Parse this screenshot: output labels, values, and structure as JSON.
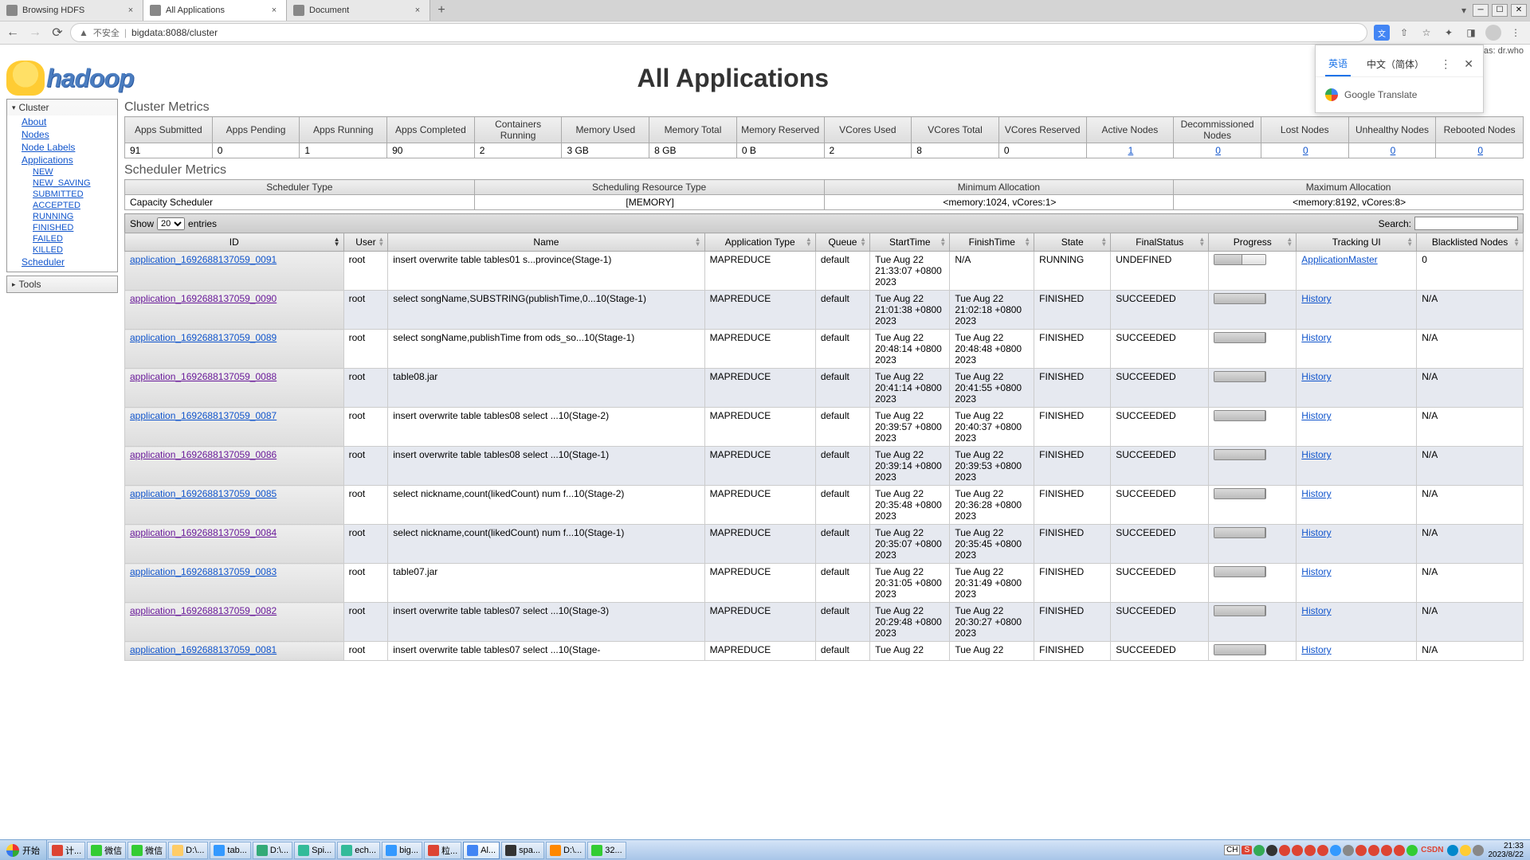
{
  "browser": {
    "tabs": [
      {
        "title": "Browsing HDFS",
        "active": false
      },
      {
        "title": "All Applications",
        "active": true
      },
      {
        "title": "Document",
        "active": false
      }
    ],
    "url_warn": "▲",
    "url_secure": "不安全",
    "url": "bigdata:8088/cluster"
  },
  "translate": {
    "tab1": "英语",
    "tab2": "中文（简体）",
    "label": "Google Translate"
  },
  "login": "gged in as: dr.who",
  "page_title": "All Applications",
  "logo_text": "hadoop",
  "sidebar": {
    "cluster": "Cluster",
    "items": [
      "About",
      "Nodes",
      "Node Labels",
      "Applications"
    ],
    "app_states": [
      "NEW",
      "NEW_SAVING",
      "SUBMITTED",
      "ACCEPTED",
      "RUNNING",
      "FINISHED",
      "FAILED",
      "KILLED"
    ],
    "scheduler": "Scheduler",
    "tools": "Tools"
  },
  "cluster_metrics": {
    "title": "Cluster Metrics",
    "headers": [
      "Apps Submitted",
      "Apps Pending",
      "Apps Running",
      "Apps Completed",
      "Containers Running",
      "Memory Used",
      "Memory Total",
      "Memory Reserved",
      "VCores Used",
      "VCores Total",
      "VCores Reserved",
      "Active Nodes",
      "Decommissioned Nodes",
      "Lost Nodes",
      "Unhealthy Nodes",
      "Rebooted Nodes"
    ],
    "values": [
      "91",
      "0",
      "1",
      "90",
      "2",
      "3 GB",
      "8 GB",
      "0 B",
      "2",
      "8",
      "0",
      "1",
      "0",
      "0",
      "0",
      "0"
    ],
    "links": [
      false,
      false,
      false,
      false,
      false,
      false,
      false,
      false,
      false,
      false,
      false,
      true,
      true,
      true,
      true,
      true
    ]
  },
  "scheduler_metrics": {
    "title": "Scheduler Metrics",
    "headers": [
      "Scheduler Type",
      "Scheduling Resource Type",
      "Minimum Allocation",
      "Maximum Allocation"
    ],
    "values": [
      "Capacity Scheduler",
      "[MEMORY]",
      "<memory:1024, vCores:1>",
      "<memory:8192, vCores:8>"
    ]
  },
  "dt": {
    "show": "Show",
    "entries": "entries",
    "page_size": "20",
    "search": "Search:"
  },
  "apps": {
    "headers": [
      "ID",
      "User",
      "Name",
      "Application Type",
      "Queue",
      "StartTime",
      "FinishTime",
      "State",
      "FinalStatus",
      "Progress",
      "Tracking UI",
      "Blacklisted Nodes"
    ],
    "rows": [
      {
        "id": "application_1692688137059_0091",
        "visited": false,
        "user": "root",
        "name": "insert overwrite table tables01 s...province(Stage-1)",
        "type": "MAPREDUCE",
        "queue": "default",
        "start": "Tue Aug 22 21:33:07 +0800 2023",
        "finish": "N/A",
        "state": "RUNNING",
        "final": "UNDEFINED",
        "progress": 55,
        "track": "ApplicationMaster",
        "black": "0"
      },
      {
        "id": "application_1692688137059_0090",
        "visited": true,
        "user": "root",
        "name": "select songName,SUBSTRING(publishTime,0...10(Stage-1)",
        "type": "MAPREDUCE",
        "queue": "default",
        "start": "Tue Aug 22 21:01:38 +0800 2023",
        "finish": "Tue Aug 22 21:02:18 +0800 2023",
        "state": "FINISHED",
        "final": "SUCCEEDED",
        "progress": 100,
        "track": "History",
        "black": "N/A"
      },
      {
        "id": "application_1692688137059_0089",
        "visited": false,
        "user": "root",
        "name": "select songName,publishTime from ods_so...10(Stage-1)",
        "type": "MAPREDUCE",
        "queue": "default",
        "start": "Tue Aug 22 20:48:14 +0800 2023",
        "finish": "Tue Aug 22 20:48:48 +0800 2023",
        "state": "FINISHED",
        "final": "SUCCEEDED",
        "progress": 100,
        "track": "History",
        "black": "N/A"
      },
      {
        "id": "application_1692688137059_0088",
        "visited": true,
        "user": "root",
        "name": "table08.jar",
        "type": "MAPREDUCE",
        "queue": "default",
        "start": "Tue Aug 22 20:41:14 +0800 2023",
        "finish": "Tue Aug 22 20:41:55 +0800 2023",
        "state": "FINISHED",
        "final": "SUCCEEDED",
        "progress": 100,
        "track": "History",
        "black": "N/A"
      },
      {
        "id": "application_1692688137059_0087",
        "visited": false,
        "user": "root",
        "name": "insert overwrite table tables08 select ...10(Stage-2)",
        "type": "MAPREDUCE",
        "queue": "default",
        "start": "Tue Aug 22 20:39:57 +0800 2023",
        "finish": "Tue Aug 22 20:40:37 +0800 2023",
        "state": "FINISHED",
        "final": "SUCCEEDED",
        "progress": 100,
        "track": "History",
        "black": "N/A"
      },
      {
        "id": "application_1692688137059_0086",
        "visited": true,
        "user": "root",
        "name": "insert overwrite table tables08 select ...10(Stage-1)",
        "type": "MAPREDUCE",
        "queue": "default",
        "start": "Tue Aug 22 20:39:14 +0800 2023",
        "finish": "Tue Aug 22 20:39:53 +0800 2023",
        "state": "FINISHED",
        "final": "SUCCEEDED",
        "progress": 100,
        "track": "History",
        "black": "N/A"
      },
      {
        "id": "application_1692688137059_0085",
        "visited": false,
        "user": "root",
        "name": "select nickname,count(likedCount) num f...10(Stage-2)",
        "type": "MAPREDUCE",
        "queue": "default",
        "start": "Tue Aug 22 20:35:48 +0800 2023",
        "finish": "Tue Aug 22 20:36:28 +0800 2023",
        "state": "FINISHED",
        "final": "SUCCEEDED",
        "progress": 100,
        "track": "History",
        "black": "N/A"
      },
      {
        "id": "application_1692688137059_0084",
        "visited": true,
        "user": "root",
        "name": "select nickname,count(likedCount) num f...10(Stage-1)",
        "type": "MAPREDUCE",
        "queue": "default",
        "start": "Tue Aug 22 20:35:07 +0800 2023",
        "finish": "Tue Aug 22 20:35:45 +0800 2023",
        "state": "FINISHED",
        "final": "SUCCEEDED",
        "progress": 100,
        "track": "History",
        "black": "N/A"
      },
      {
        "id": "application_1692688137059_0083",
        "visited": false,
        "user": "root",
        "name": "table07.jar",
        "type": "MAPREDUCE",
        "queue": "default",
        "start": "Tue Aug 22 20:31:05 +0800 2023",
        "finish": "Tue Aug 22 20:31:49 +0800 2023",
        "state": "FINISHED",
        "final": "SUCCEEDED",
        "progress": 100,
        "track": "History",
        "black": "N/A"
      },
      {
        "id": "application_1692688137059_0082",
        "visited": true,
        "user": "root",
        "name": "insert overwrite table tables07 select ...10(Stage-3)",
        "type": "MAPREDUCE",
        "queue": "default",
        "start": "Tue Aug 22 20:29:48 +0800 2023",
        "finish": "Tue Aug 22 20:30:27 +0800 2023",
        "state": "FINISHED",
        "final": "SUCCEEDED",
        "progress": 100,
        "track": "History",
        "black": "N/A"
      },
      {
        "id": "application_1692688137059_0081",
        "visited": false,
        "user": "root",
        "name": "insert overwrite table tables07 select ...10(Stage-",
        "type": "MAPREDUCE",
        "queue": "default",
        "start": "Tue Aug 22",
        "finish": "Tue Aug 22",
        "state": "FINISHED",
        "final": "SUCCEEDED",
        "progress": 100,
        "track": "History",
        "black": "N/A"
      }
    ]
  },
  "taskbar": {
    "start": "开始",
    "items": [
      {
        "label": "计...",
        "color": "#d43"
      },
      {
        "label": "微信",
        "color": "#3c3"
      },
      {
        "label": "微信",
        "color": "#3c3"
      },
      {
        "label": "D:\\...",
        "color": "#fc6"
      },
      {
        "label": "tab...",
        "color": "#39f"
      },
      {
        "label": "D:\\...",
        "color": "#3a7"
      },
      {
        "label": "Spi...",
        "color": "#3b9"
      },
      {
        "label": "ech...",
        "color": "#3b9"
      },
      {
        "label": "big...",
        "color": "#39f"
      },
      {
        "label": "粒...",
        "color": "#d43"
      },
      {
        "label": "Al...",
        "color": "#4285f4",
        "active": true
      },
      {
        "label": "spa...",
        "color": "#333"
      },
      {
        "label": "D:\\...",
        "color": "#f80"
      },
      {
        "label": "32...",
        "color": "#3c3"
      }
    ],
    "lang": "CH",
    "ime": "S",
    "time": "21:33",
    "date": "2023/8/22"
  }
}
